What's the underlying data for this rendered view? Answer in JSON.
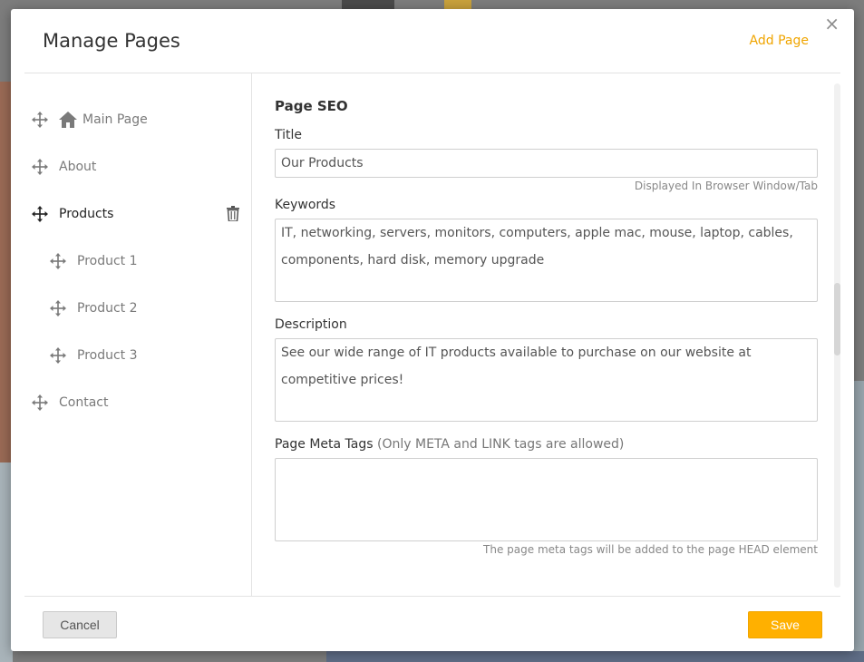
{
  "dialog": {
    "title": "Manage Pages",
    "add_page_label": "Add Page",
    "close_glyph": "×"
  },
  "pages": [
    {
      "label": "Main Page",
      "icon": "home-icon",
      "level": 0,
      "active": false
    },
    {
      "label": "About",
      "level": 0,
      "active": false
    },
    {
      "label": "Products",
      "level": 0,
      "active": true
    },
    {
      "label": "Product 1",
      "level": 1,
      "active": false
    },
    {
      "label": "Product 2",
      "level": 1,
      "active": false
    },
    {
      "label": "Product 3",
      "level": 1,
      "active": false
    },
    {
      "label": "Contact",
      "level": 0,
      "active": false
    }
  ],
  "seo": {
    "section_title": "Page SEO",
    "title_label": "Title",
    "title_value": "Our Products",
    "title_hint": "Displayed In Browser Window/Tab",
    "keywords_label": "Keywords",
    "keywords_value": "IT, networking, servers, monitors, computers, apple mac, mouse, laptop, cables, components, hard disk, memory upgrade",
    "description_label": "Description",
    "description_value": "See our wide range of IT products available to purchase on our website at competitive prices!",
    "meta_label": "Page Meta Tags",
    "meta_label_note": "(Only META and LINK tags are allowed)",
    "meta_value": "",
    "meta_hint": "The page meta tags will be added to the page HEAD element"
  },
  "footer": {
    "cancel_label": "Cancel",
    "save_label": "Save"
  },
  "colors": {
    "accent": "#ffb000",
    "link": "#f0a500"
  }
}
